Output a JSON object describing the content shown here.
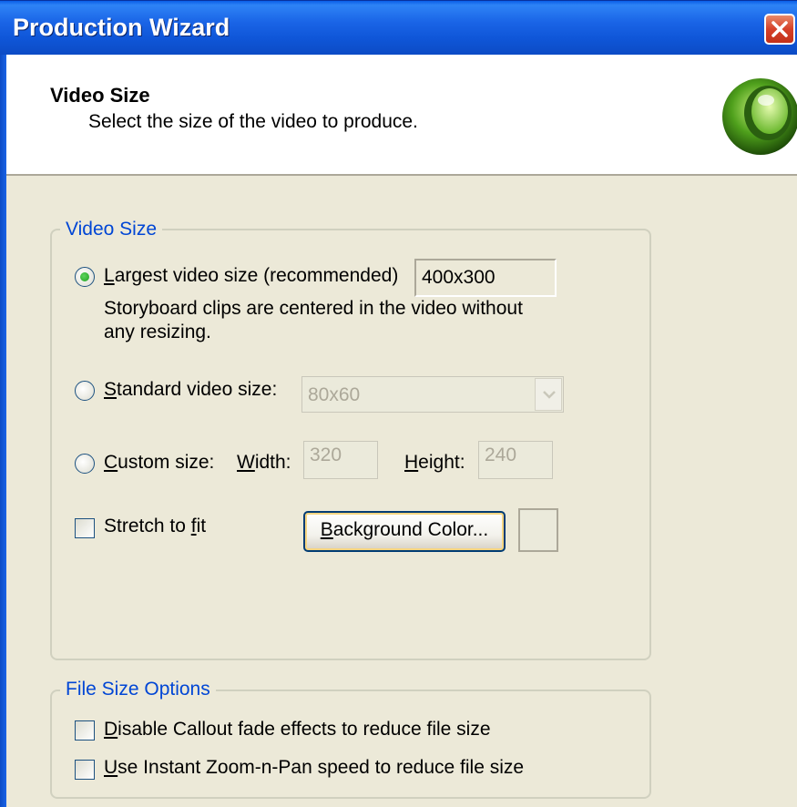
{
  "window": {
    "title": "Production Wizard"
  },
  "header": {
    "title": "Video Size",
    "subtitle": "Select the size of the video to produce."
  },
  "video_size_group": {
    "legend": "Video Size",
    "largest": {
      "mnemonic": "L",
      "label_rest": "argest video size (recommended)",
      "selected": true,
      "value": "400x300",
      "description_line1": "Storyboard clips are centered in the video without",
      "description_line2": "any resizing."
    },
    "standard": {
      "mnemonic": "S",
      "label_rest": "tandard video size:",
      "selected": false,
      "value": "80x60"
    },
    "custom": {
      "mnemonic": "C",
      "label_rest": "ustom size:",
      "selected": false,
      "width_mnemonic": "W",
      "width_rest": "idth:",
      "width_value": "320",
      "height_mnemonic": "H",
      "height_rest": "eight:",
      "height_value": "240"
    },
    "stretch": {
      "label_pre": "Stretch to ",
      "mnemonic": "f",
      "label_post": "it",
      "checked": false
    },
    "background_button": {
      "mnemonic": "B",
      "label_rest": "ackground Color..."
    }
  },
  "file_size_group": {
    "legend": "File Size Options",
    "disable_fade": {
      "mnemonic": "D",
      "label_rest": "isable Callout fade effects to reduce file size",
      "checked": false
    },
    "instant_zoom": {
      "mnemonic": "U",
      "label_rest": "se Instant Zoom-n-Pan speed to reduce file size",
      "checked": false
    }
  },
  "icons": {
    "close": "close-icon",
    "logo": "camtasia-logo-icon",
    "dropdown": "chevron-down-icon"
  },
  "colors": {
    "titlebar": "#0c4bc5",
    "legend_text": "#0046d5",
    "dialog_bg": "#ece9d8",
    "close_button": "#d6412a"
  }
}
